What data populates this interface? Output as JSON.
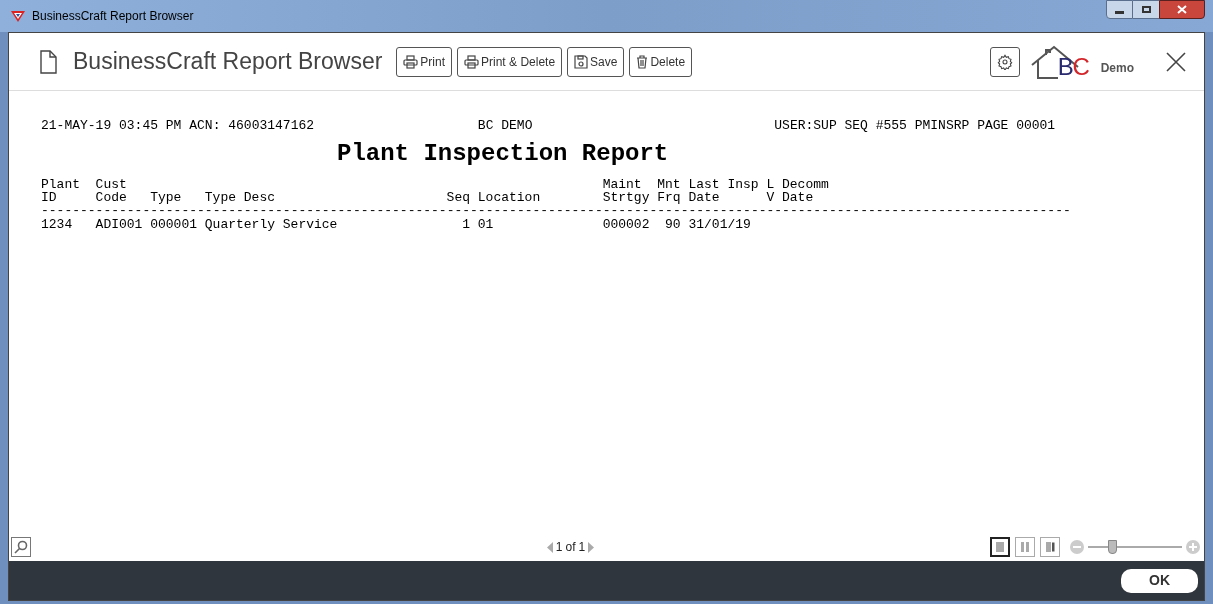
{
  "window": {
    "title": "BusinessCraft Report Browser"
  },
  "app_title": "BusinessCraft Report Browser",
  "toolbar": [
    {
      "kind": "print",
      "label": "Print"
    },
    {
      "kind": "print",
      "label": "Print & Delete"
    },
    {
      "kind": "save",
      "label": "Save"
    },
    {
      "kind": "delete",
      "label": "Delete"
    }
  ],
  "logo": {
    "letters": [
      "B",
      "C"
    ],
    "caption": "Demo"
  },
  "report": {
    "header_left": "21-MAY-19 03:45 PM ACN: 46003147162",
    "header_center": "BC DEMO",
    "header_right": "USER:SUP SEQ #555 PMINSRP PAGE 00001",
    "title": "Plant Inspection Report",
    "columns": [
      {
        "lines": [
          "Plant",
          "ID"
        ]
      },
      {
        "lines": [
          "Cust",
          "Code"
        ]
      },
      {
        "lines": [
          "Type"
        ]
      },
      {
        "lines": [
          "Type Desc"
        ]
      },
      {
        "lines": [
          "Seq"
        ]
      },
      {
        "lines": [
          "Location"
        ]
      },
      {
        "lines": [
          "Maint",
          "Strtgy"
        ]
      },
      {
        "lines": [
          "Mnt",
          "Frq"
        ]
      },
      {
        "lines": [
          "Last Insp",
          "Date"
        ]
      },
      {
        "lines": [
          "L",
          "V"
        ]
      },
      {
        "lines": [
          "Decomm",
          "Date"
        ]
      }
    ],
    "rule": "------------------------------------------------------------------------------------------------------------------------------------",
    "rows": [
      [
        "1234",
        "ADI001",
        "000001",
        "Quarterly Service",
        "1",
        "01",
        "000002",
        "90",
        "31/01/19"
      ]
    ]
  },
  "pager": {
    "current": "1",
    "of": "of",
    "total": "1"
  },
  "view_modes": [
    {
      "selected": true
    },
    {
      "selected": false
    },
    {
      "selected": false
    }
  ],
  "zoom": {
    "level": 0.25
  },
  "ok_button": "OK"
}
